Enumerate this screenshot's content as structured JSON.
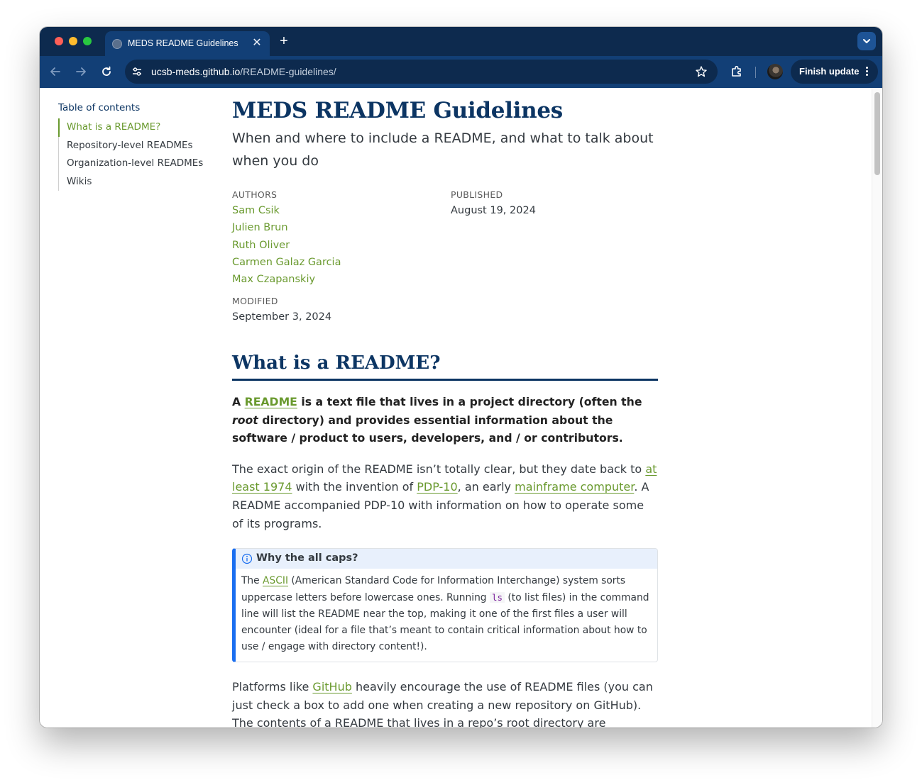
{
  "browser": {
    "tab_title": "MEDS README Guidelines",
    "new_tab_symbol": "+",
    "close_symbol": "✕",
    "url_host": "ucsb-meds.github.io",
    "url_path": "/README-guidelines/",
    "finish_update_label": "Finish update",
    "icons": [
      "back-arrow-icon",
      "forward-arrow-icon",
      "reload-icon",
      "site-settings-icon",
      "bookmark-star-icon",
      "extensions-icon",
      "profile-avatar",
      "menu-kebab-icon",
      "tab-search-icon"
    ]
  },
  "toc": {
    "title": "Table of contents",
    "items": [
      {
        "label": "What is a README?",
        "active": true
      },
      {
        "label": "Repository-level READMEs",
        "active": false
      },
      {
        "label": "Organization-level READMEs",
        "active": false
      },
      {
        "label": "Wikis",
        "active": false
      }
    ]
  },
  "header": {
    "title": "MEDS README Guidelines",
    "subtitle": "When and where to include a README, and what to talk about when you do"
  },
  "meta": {
    "authors_label": "AUTHORS",
    "authors": [
      "Sam Csik",
      "Julien Brun",
      "Ruth Oliver",
      "Carmen Galaz Garcia",
      "Max Czapanskiy"
    ],
    "published_label": "PUBLISHED",
    "published": "August 19, 2024",
    "modified_label": "MODIFIED",
    "modified": "September 3, 2024"
  },
  "section": {
    "heading": "What is a README?",
    "p1": {
      "a": "A ",
      "link": "README",
      "b": " is a text file that lives in a project directory (often the ",
      "em": "root",
      "c": " directory) and provides essential information about the software / product to users, developers, and / or contributors."
    },
    "p2": {
      "a": "The exact origin of the README isn’t totally clear, but they date back to ",
      "link1": "at least 1974",
      "b": " with the invention of ",
      "link2": "PDP-10",
      "c": ", an early ",
      "link3": "mainframe computer",
      "d": ". A README accompanied PDP-10 with information on how to operate some of its programs."
    },
    "callout": {
      "title": "Why the all caps?",
      "a": "The ",
      "link": "ASCII",
      "b": " (American Standard Code for Information Interchange) system sorts uppercase letters before lowercase ones. Running ",
      "code": "ls",
      "c": " (to list files) in the command line will list the README near the top, making it one of the first files a user will encounter (ideal for a file that’s meant to contain critical information about how to use / engage with directory content!)."
    },
    "p3": {
      "a": "Platforms like ",
      "link": "GitHub",
      "b": " heavily encourage the use of README files (you can just check a box to add one when creating a new repository on GitHub). The contents of a README that lives in a repo’s root directory are automatically displayed on the repo’s landing page (but note that you can also include"
    }
  },
  "colors": {
    "chrome_dark": "#0d2a4e",
    "chrome_toolbar": "#123f76",
    "heading_navy": "#0c3563",
    "link_green": "#6a9a2f",
    "callout_blue": "#1a6ef0"
  }
}
